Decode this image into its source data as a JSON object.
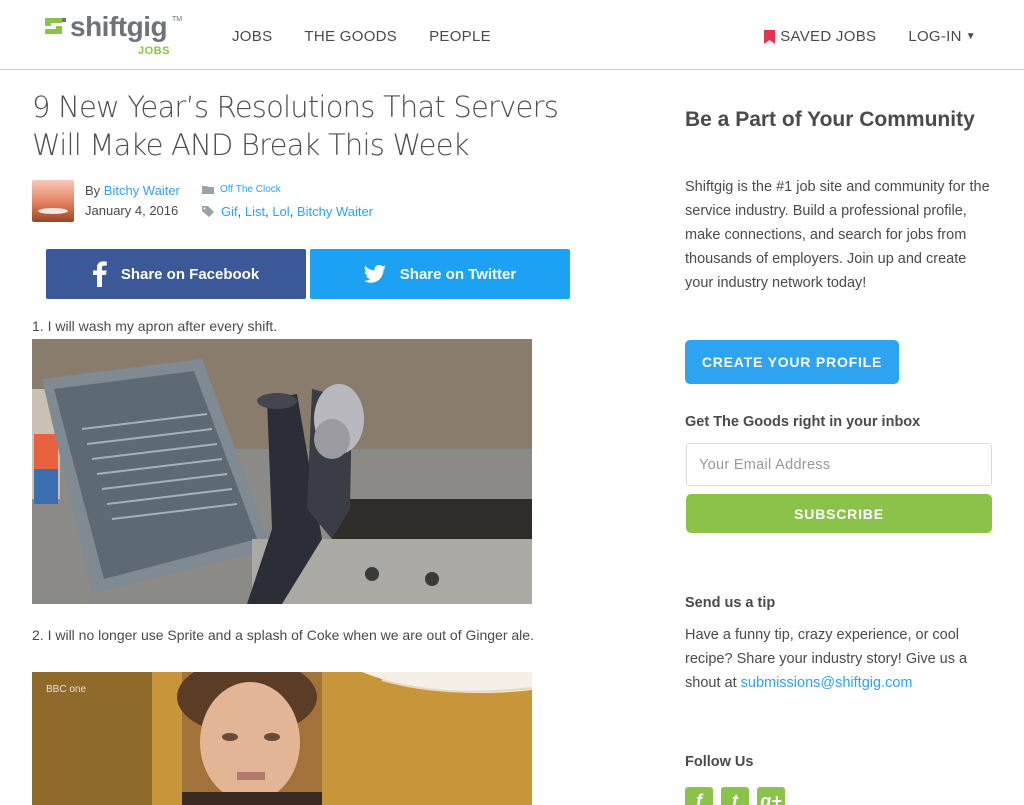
{
  "brand": {
    "name": "shiftgig",
    "tm": "TM",
    "sub": "JOBS",
    "color_primary": "#8bc34a",
    "color_text": "#6d7478"
  },
  "nav": {
    "items": [
      {
        "label": "JOBS"
      },
      {
        "label": "THE GOODS"
      },
      {
        "label": "PEOPLE"
      }
    ],
    "saved_jobs": "SAVED JOBS",
    "login": "LOG-IN"
  },
  "article": {
    "title": "9 New Year’s Resolutions That Servers Will Make AND Break This Week",
    "by_prefix": "By",
    "author": "Bitchy Waiter",
    "date": "January 4, 2016",
    "category": "Off The Clock",
    "tags": [
      "Gif",
      "List",
      "Lol",
      "Bitchy Waiter"
    ],
    "share_facebook": "Share on Facebook",
    "share_twitter": "Share on Twitter",
    "items": [
      {
        "text": "1. I will wash my apron after every shift."
      },
      {
        "text": "2. I will no longer use Sprite and a splash of Coke when we are out of Ginger ale."
      }
    ],
    "gif2_watermark": "BBC one"
  },
  "sidebar": {
    "heading": "Be a Part of Your Community",
    "intro": "Shiftgig is the #1 job site and community for the service industry. Build a professional profile, make connections, and search for jobs from thousands of employers. Join up and create your industry network today!",
    "create_profile": "CREATE YOUR PROFILE",
    "goods_heading": "Get The Goods right in your inbox",
    "email_placeholder": "Your Email Address",
    "subscribe": "SUBSCRIBE",
    "tip_heading": "Send us a tip",
    "tip_text": "Have a funny tip, crazy experience, or cool recipe? Share your industry story! Give us a shout at",
    "tip_email": "submissions@shiftgig.com",
    "follow_heading": "Follow Us",
    "social": [
      {
        "icon": "facebook-icon",
        "glyph": "f"
      },
      {
        "icon": "twitter-icon",
        "glyph": "t"
      },
      {
        "icon": "google-plus-icon",
        "glyph": "g+"
      }
    ]
  },
  "colors": {
    "link": "#2ea3f2",
    "facebook": "#3b5998",
    "twitter": "#1da1f2",
    "accent_green": "#8bc34a",
    "saved_icon": "#e0344f"
  }
}
